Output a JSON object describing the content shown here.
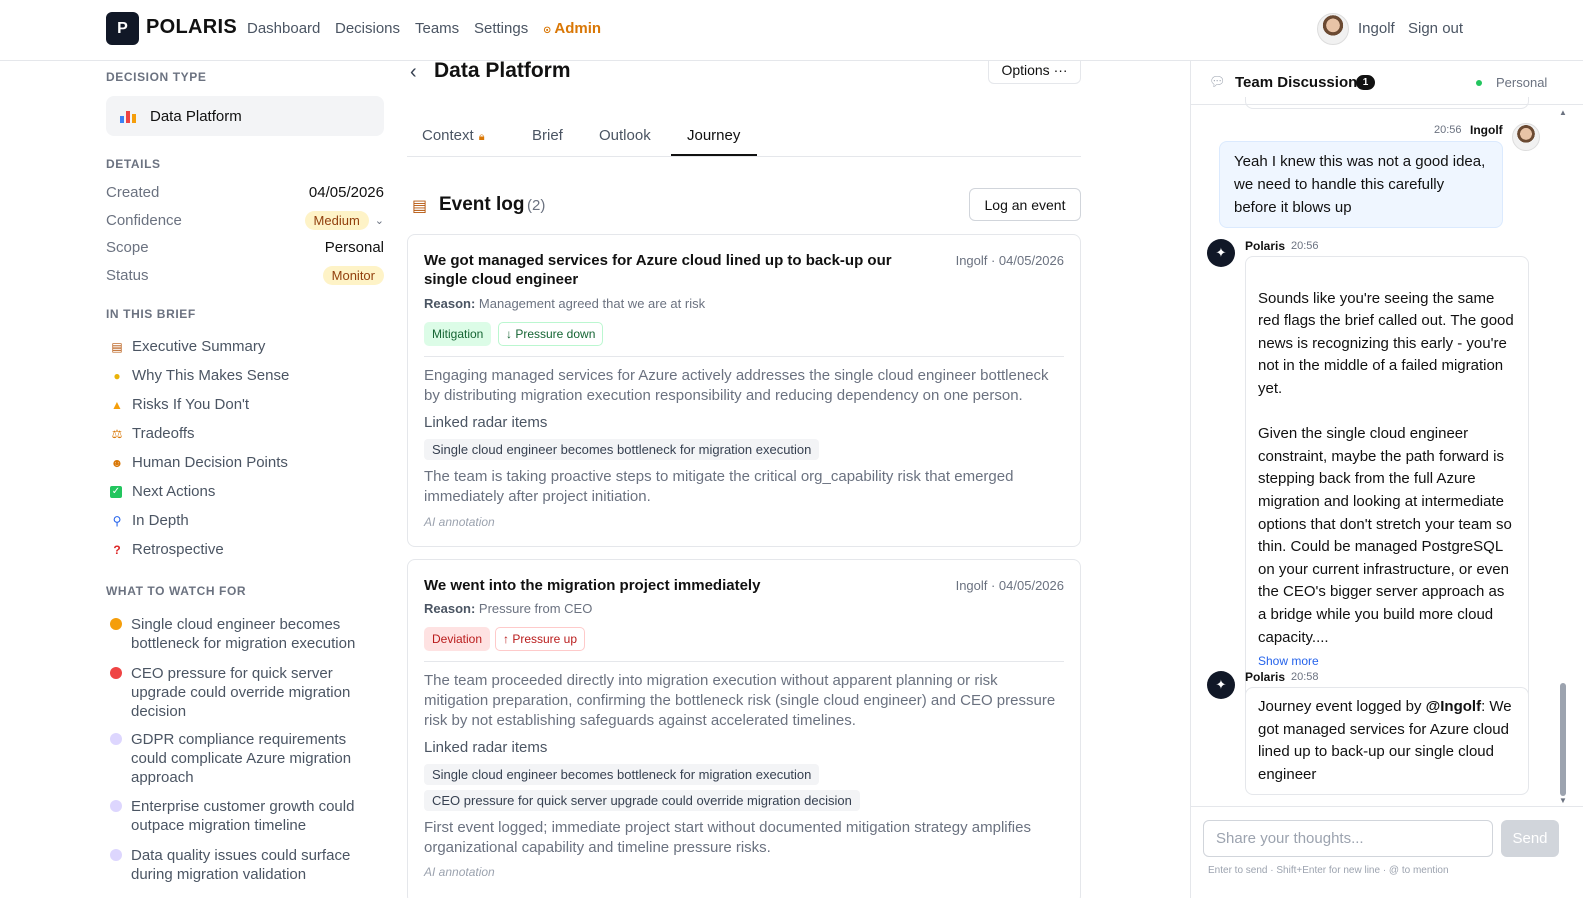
{
  "nav": {
    "logo_letter": "P",
    "brand": "POLARIS",
    "links": [
      "Dashboard",
      "Decisions",
      "Teams",
      "Settings"
    ],
    "admin": "Admin",
    "user": "Ingolf",
    "signout": "Sign out"
  },
  "sidebar": {
    "decision_type_heading": "DECISION TYPE",
    "decision_type": "Data Platform",
    "details_heading": "DETAILS",
    "details": [
      {
        "label": "Created",
        "value": "04/05/2026"
      },
      {
        "label": "Confidence",
        "value": "Medium"
      },
      {
        "label": "Scope",
        "value": "Personal"
      },
      {
        "label": "Status",
        "value": "Monitor"
      }
    ],
    "brief_heading": "IN THIS BRIEF",
    "brief_items": [
      {
        "icon": "clipboard-icon",
        "label": "Executive Summary"
      },
      {
        "icon": "lightbulb-icon",
        "label": "Why This Makes Sense"
      },
      {
        "icon": "warning-icon",
        "label": "Risks If You Don't"
      },
      {
        "icon": "scales-icon",
        "label": "Tradeoffs"
      },
      {
        "icon": "person-icon",
        "label": "Human Decision Points"
      },
      {
        "icon": "check-icon",
        "label": "Next Actions"
      },
      {
        "icon": "magnifier-icon",
        "label": "In Depth"
      },
      {
        "icon": "question-icon",
        "label": "Retrospective"
      }
    ],
    "watch_heading": "WHAT TO WATCH FOR",
    "watch_items": [
      {
        "label": "Single cloud engineer becomes bottleneck for migration execution",
        "color": "#f59e0b"
      },
      {
        "label": "CEO pressure for quick server upgrade could override migration decision",
        "color": "#ef4444"
      },
      {
        "label": "GDPR compliance requirements could complicate Azure migration approach",
        "color": "#c4b5fd"
      },
      {
        "label": "Enterprise customer growth could outpace migration timeline",
        "color": "#c4b5fd"
      },
      {
        "label": "Data quality issues could surface during migration validation",
        "color": "#c4b5fd"
      }
    ]
  },
  "main": {
    "title": "Data Platform",
    "options": "Options ···",
    "tabs": [
      "Context",
      "Brief",
      "Outlook",
      "Journey"
    ],
    "active_tab": "Journey",
    "event_log_title": "Event log",
    "event_log_count": "(2)",
    "log_button": "Log an event",
    "events": [
      {
        "title": "We got managed services for Azure cloud lined up to back-up our single cloud engineer",
        "meta": "Ingolf · 04/05/2026",
        "reason_label": "Reason:",
        "reason": "Management agreed that we are at risk",
        "tag": "Mitigation",
        "pressure": "↓ Pressure down",
        "summary": "Engaging managed services for Azure actively addresses the single cloud engineer bottleneck by distributing migration execution responsibility and reducing dependency on one person.",
        "linked_heading": "Linked radar items",
        "linked": [
          "Single cloud engineer becomes bottleneck for migration execution"
        ],
        "analysis": "The team is taking proactive steps to mitigate the critical org_capability risk that emerged immediately after project initiation.",
        "annotation": "AI annotation"
      },
      {
        "title": "We went into the migration project immediately",
        "meta": "Ingolf · 04/05/2026",
        "reason_label": "Reason:",
        "reason": "Pressure from CEO",
        "tag": "Deviation",
        "pressure": "↑ Pressure up",
        "summary": "The team proceeded directly into migration execution without apparent planning or risk mitigation preparation, confirming the bottleneck risk (single cloud engineer) and CEO pressure risk by not establishing safeguards against accelerated timelines.",
        "linked_heading": "Linked radar items",
        "linked": [
          "Single cloud engineer becomes bottleneck for migration execution",
          "CEO pressure for quick server upgrade could override migration decision"
        ],
        "analysis": "First event logged; immediate project start without documented mitigation strategy amplifies organizational capability and timeline pressure risks.",
        "annotation": "AI annotation"
      }
    ]
  },
  "chat": {
    "title": "Team Discussion",
    "badge": "1",
    "scope": "Personal",
    "messages": [
      {
        "author": "Ingolf",
        "time": "20:56",
        "text": "Yeah I knew this was not a good idea, we need to handle this carefully before it blows up"
      },
      {
        "author": "Polaris",
        "time": "20:56",
        "text": "Sounds like you're seeing the same red flags the brief called out. The good news is recognizing this early - you're not in the middle of a failed migration yet.\n\nGiven the single cloud engineer constraint, maybe the path forward is stepping back from the full Azure migration and looking at intermediate options that don't stretch your team so thin. Could be managed PostgreSQL on your current infrastructure, or even the CEO's bigger server approach as a bridge while you build more cloud capacity....",
        "show_more": "Show more"
      },
      {
        "author": "Polaris",
        "time": "20:58",
        "prefix": "Journey event logged by ",
        "mention": "@Ingolf",
        "text": ": We got managed services for Azure cloud lined up to back-up our single cloud engineer"
      }
    ],
    "input_placeholder": "Share your thoughts...",
    "send": "Send",
    "hint": "Enter to send · Shift+Enter for new line · @ to mention"
  }
}
